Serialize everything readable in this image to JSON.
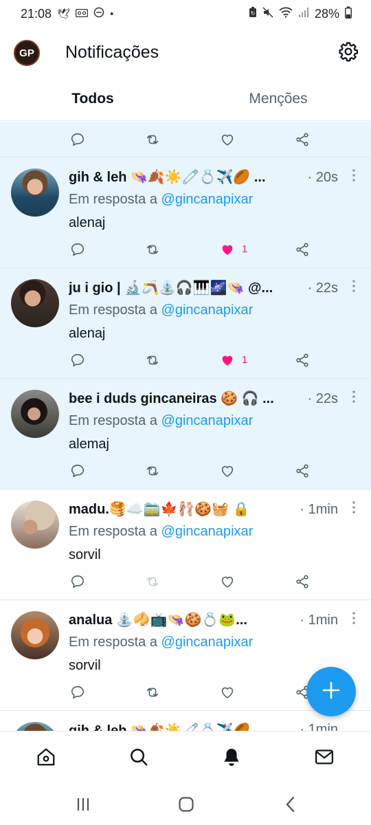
{
  "status_bar": {
    "time": "21:08",
    "battery": "28%",
    "left_icons": [
      "bird-icon",
      "voicemail-icon",
      "minus-circle-icon",
      "dot-icon"
    ],
    "right_icons": [
      "battery-saver-icon",
      "mute-icon",
      "wifi-icon",
      "signal-icon",
      "battery-icon"
    ]
  },
  "header": {
    "avatar_initials": "GP",
    "title": "Notificações",
    "settings_icon": "gear-icon"
  },
  "tabs": [
    {
      "label": "Todos",
      "active": true
    },
    {
      "label": "Menções",
      "active": false
    }
  ],
  "colors": {
    "accent": "#1d9bf0",
    "like": "#f91880",
    "unread_bg": "#e8f5fd",
    "muted": "#536471"
  },
  "notifications": [
    {
      "name": "gih & leh 👒🍂☀️🧷💍✈️🏉 ...",
      "time": "· 20s",
      "reply_prefix": "Em resposta a",
      "mention": "@gincanapixar",
      "text": "alenaj",
      "liked": true,
      "like_count": "1",
      "unread": true
    },
    {
      "name": "ju i gio | 🔬🪃⛲🎧🎹🌌👒 @...",
      "time": "· 22s",
      "reply_prefix": "Em resposta a",
      "mention": "@gincanapixar",
      "text": "alenaj",
      "liked": true,
      "like_count": "1",
      "unread": true
    },
    {
      "name": "bee i duds gincaneiras 🍪 🎧 ...",
      "time": "· 22s",
      "reply_prefix": "Em resposta a",
      "mention": "@gincanapixar",
      "text": "alemaj",
      "liked": false,
      "like_count": "",
      "unread": true
    },
    {
      "name": "madu.🥞☁️🚞🍁🩰🍪🧺 🔒",
      "time": "· 1min",
      "reply_prefix": "Em resposta a",
      "mention": "@gincanapixar",
      "text": "sorvil",
      "liked": false,
      "like_count": "",
      "unread": false
    },
    {
      "name": "analua ⛲🥠📺👒🍪💍🐸...",
      "time": "· 1min",
      "reply_prefix": "Em resposta a",
      "mention": "@gincanapixar",
      "text": "sorvil",
      "liked": false,
      "like_count": "",
      "unread": false
    },
    {
      "name": "gih & leh 👒🍂☀️🧷💍✈️🏉",
      "time": "· 1min",
      "unread": false
    }
  ],
  "fab": {
    "icon": "plus-icon"
  },
  "bottom_nav": [
    "home-icon",
    "search-icon",
    "bell-icon",
    "mail-icon"
  ],
  "system_nav": [
    "recent-apps-icon",
    "home-button-icon",
    "back-icon"
  ]
}
